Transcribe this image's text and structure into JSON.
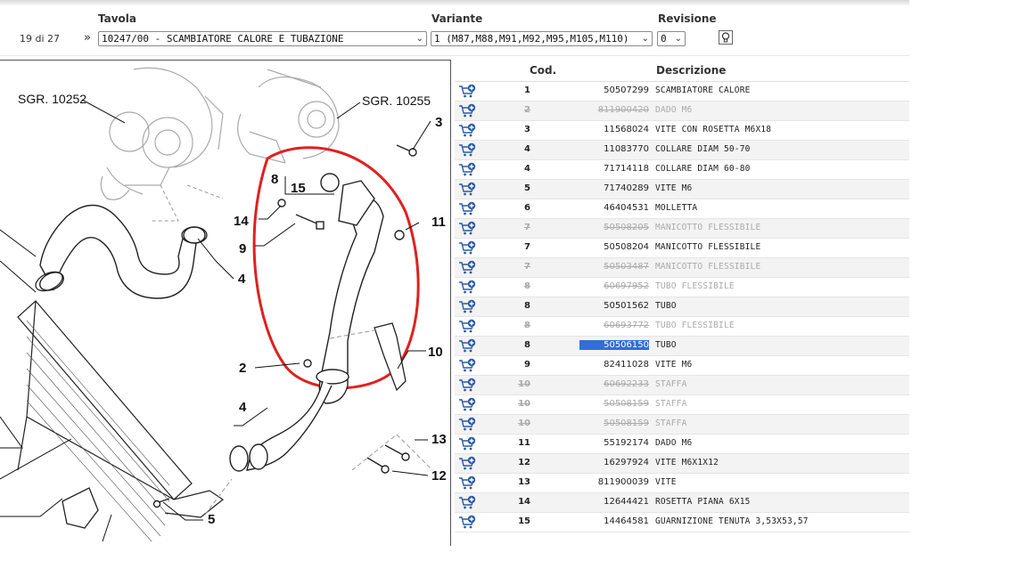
{
  "header": {
    "tavola_label": "Tavola",
    "variante_label": "Variante",
    "revisione_label": "Revisione",
    "counter": "19 di 27",
    "nav_symbol": "»",
    "tavola_value": "10247/00 - SCAMBIATORE CALORE E TUBAZIONE",
    "variante_value": "1 (M87,M88,M91,M92,M95,M105,M110)",
    "revisione_value": "0",
    "chevron": "⌄"
  },
  "drawing": {
    "ref_left": "SGR. 10252",
    "ref_right": "SGR. 10255",
    "callouts": [
      "3",
      "8",
      "15",
      "14",
      "11",
      "9",
      "4",
      "2",
      "10",
      "4",
      "13",
      "12",
      "5"
    ],
    "highlight_color": "#e02020"
  },
  "table": {
    "col_cod": "Cod.",
    "col_descrizione": "Descrizione",
    "rows": [
      {
        "num": "1",
        "code": "50507299",
        "desc": "SCAMBIATORE CALORE",
        "disabled": false
      },
      {
        "num": "2",
        "code": "811900420",
        "desc": "DADO M6",
        "disabled": true
      },
      {
        "num": "3",
        "code": "11568024",
        "desc": "VITE CON ROSETTA M6X18",
        "disabled": false
      },
      {
        "num": "4",
        "code": "11083770",
        "desc": "COLLARE DIAM 50-70",
        "disabled": false
      },
      {
        "num": "4",
        "code": "71714118",
        "desc": "COLLARE DIAM 60-80",
        "disabled": false
      },
      {
        "num": "5",
        "code": "71740289",
        "desc": "VITE M6",
        "disabled": false
      },
      {
        "num": "6",
        "code": "46404531",
        "desc": "MOLLETTA",
        "disabled": false
      },
      {
        "num": "7",
        "code": "50508205",
        "desc": "MANICOTTO FLESSIBILE",
        "disabled": true
      },
      {
        "num": "7",
        "code": "50508204",
        "desc": "MANICOTTO FLESSIBILE",
        "disabled": false
      },
      {
        "num": "7",
        "code": "50503487",
        "desc": "MANICOTTO FLESSIBILE",
        "disabled": true
      },
      {
        "num": "8",
        "code": "60697952",
        "desc": "TUBO FLESSIBILE",
        "disabled": true
      },
      {
        "num": "8",
        "code": "50501562",
        "desc": "TUBO",
        "disabled": false
      },
      {
        "num": "8",
        "code": "60693772",
        "desc": "TUBO FLESSIBILE",
        "disabled": true
      },
      {
        "num": "8",
        "code": "50506150",
        "desc": "TUBO",
        "disabled": false,
        "highlighted": true
      },
      {
        "num": "9",
        "code": "82411028",
        "desc": "VITE M6",
        "disabled": false
      },
      {
        "num": "10",
        "code": "60692233",
        "desc": "STAFFA",
        "disabled": true
      },
      {
        "num": "10",
        "code": "50508159",
        "desc": "STAFFA",
        "disabled": true
      },
      {
        "num": "10",
        "code": "50508159",
        "desc": "STAFFA",
        "disabled": true
      },
      {
        "num": "11",
        "code": "55192174",
        "desc": "DADO M6",
        "disabled": false
      },
      {
        "num": "12",
        "code": "16297924",
        "desc": "VITE M6X1X12",
        "disabled": false
      },
      {
        "num": "13",
        "code": "811900039",
        "desc": "VITE",
        "disabled": false
      },
      {
        "num": "14",
        "code": "12644421",
        "desc": "ROSETTA PIANA 6X15",
        "disabled": false
      },
      {
        "num": "15",
        "code": "14464581",
        "desc": "GUARNIZIONE TENUTA 3,53X53,57",
        "disabled": false
      }
    ]
  },
  "colors": {
    "accent": "#2f6fd6",
    "cart_icon": "#2a5aa8",
    "highlight": "#e02020"
  }
}
